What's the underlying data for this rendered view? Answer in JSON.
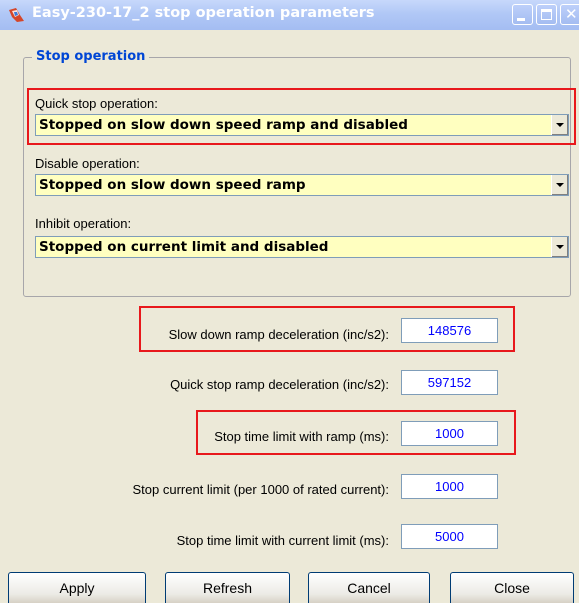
{
  "window": {
    "title": "Easy-230-17_2 stop operation parameters",
    "app_icon": "app-logo-icon",
    "buttons": [
      "minimize-icon",
      "maximize-icon",
      "close-icon"
    ]
  },
  "stop_group": {
    "legend": "Stop operation",
    "fields": [
      {
        "label": "Quick stop operation:",
        "value": "Stopped on slow down speed ramp and disabled",
        "highlighted": true
      },
      {
        "label": "Disable operation:",
        "value": "Stopped on slow down speed ramp",
        "highlighted": false
      },
      {
        "label": "Inhibit operation:",
        "value": "Stopped on current limit and disabled",
        "highlighted": false
      }
    ]
  },
  "params": [
    {
      "label": "Slow down ramp deceleration (inc/s2):",
      "value": "148576",
      "highlighted": true
    },
    {
      "label": "Quick stop ramp deceleration (inc/s2):",
      "value": "597152",
      "highlighted": false
    },
    {
      "label": "Stop time limit with ramp (ms):",
      "value": "1000",
      "highlighted": true
    },
    {
      "label": "Stop current limit (per 1000 of rated current):",
      "value": "1000",
      "highlighted": false
    },
    {
      "label": "Stop time limit with current limit (ms):",
      "value": "5000",
      "highlighted": false
    }
  ],
  "buttons": {
    "apply": "Apply",
    "refresh": "Refresh",
    "cancel": "Cancel",
    "close": "Close"
  },
  "colors": {
    "title_bar": "#b1c8f6",
    "combo_background": "#ffffc0",
    "value_text": "#0000ff",
    "highlight": "#e8181c",
    "legend": "#0046d5"
  }
}
